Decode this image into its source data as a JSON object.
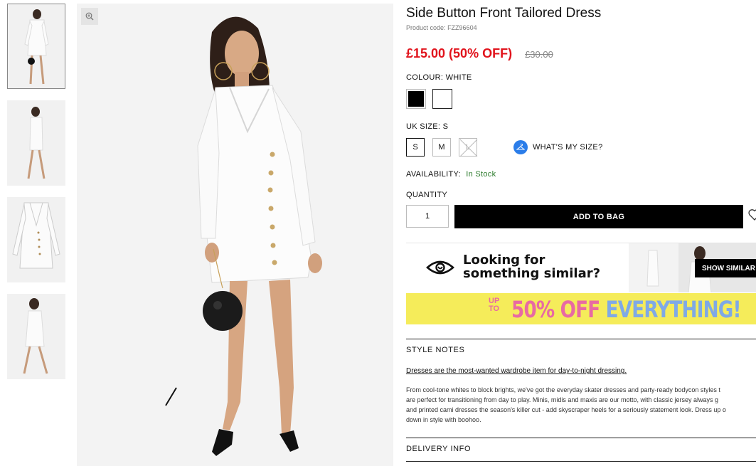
{
  "product": {
    "title": "Side Button Front Tailored Dress",
    "code_label": "Product code:",
    "code": "FZZ96604",
    "price": "£15.00 (50% OFF)",
    "old_price": "£30.00"
  },
  "colour": {
    "label": "COLOUR:",
    "selected": "WHITE",
    "swatches": [
      {
        "name": "black",
        "color": "#000000"
      },
      {
        "name": "white",
        "color": "#ffffff"
      }
    ]
  },
  "size": {
    "label": "UK SIZE:",
    "selected": "S",
    "options": [
      {
        "label": "S",
        "status": "selected"
      },
      {
        "label": "M",
        "status": "available"
      },
      {
        "label": "L",
        "status": "out-of-stock"
      }
    ],
    "guide_label": "WHAT'S MY SIZE?"
  },
  "availability": {
    "label": "AVAILABILITY:",
    "value": "In Stock"
  },
  "quantity": {
    "label": "QUANTITY",
    "value": "1"
  },
  "add_to_bag": "ADD TO BAG",
  "similar": {
    "line1": "Looking for",
    "line2": "something similar?",
    "button": "SHOW SIMILAR"
  },
  "promo": {
    "upto": "UP TO",
    "text_pink": "50% OFF",
    "text_blue": "EVERYTHING!"
  },
  "style_notes": {
    "title": "STYLE NOTES",
    "headline": "Dresses are the most-wanted wardrobe item for day-to-night dressing.",
    "body": [
      "From cool-tone whites to block brights, we've got the everyday skater dresses and party-ready bodycon styles t",
      "are perfect for transitioning from day to play. Minis, midis and maxis are our motto, with classic jersey always g",
      "and printed cami dresses the season's killer cut - add skyscraper heels for a seriously statement look. Dress up o",
      "down in style with boohoo."
    ]
  },
  "delivery_info": "DELIVERY INFO",
  "colors": {
    "sale_red": "#e1131c",
    "in_stock_green": "#2a7a2a",
    "size_guide_blue": "#2b7de9",
    "promo_yellow": "#f5ec5a",
    "promo_pink": "#e86aa3",
    "promo_blue": "#7fa9e6"
  }
}
